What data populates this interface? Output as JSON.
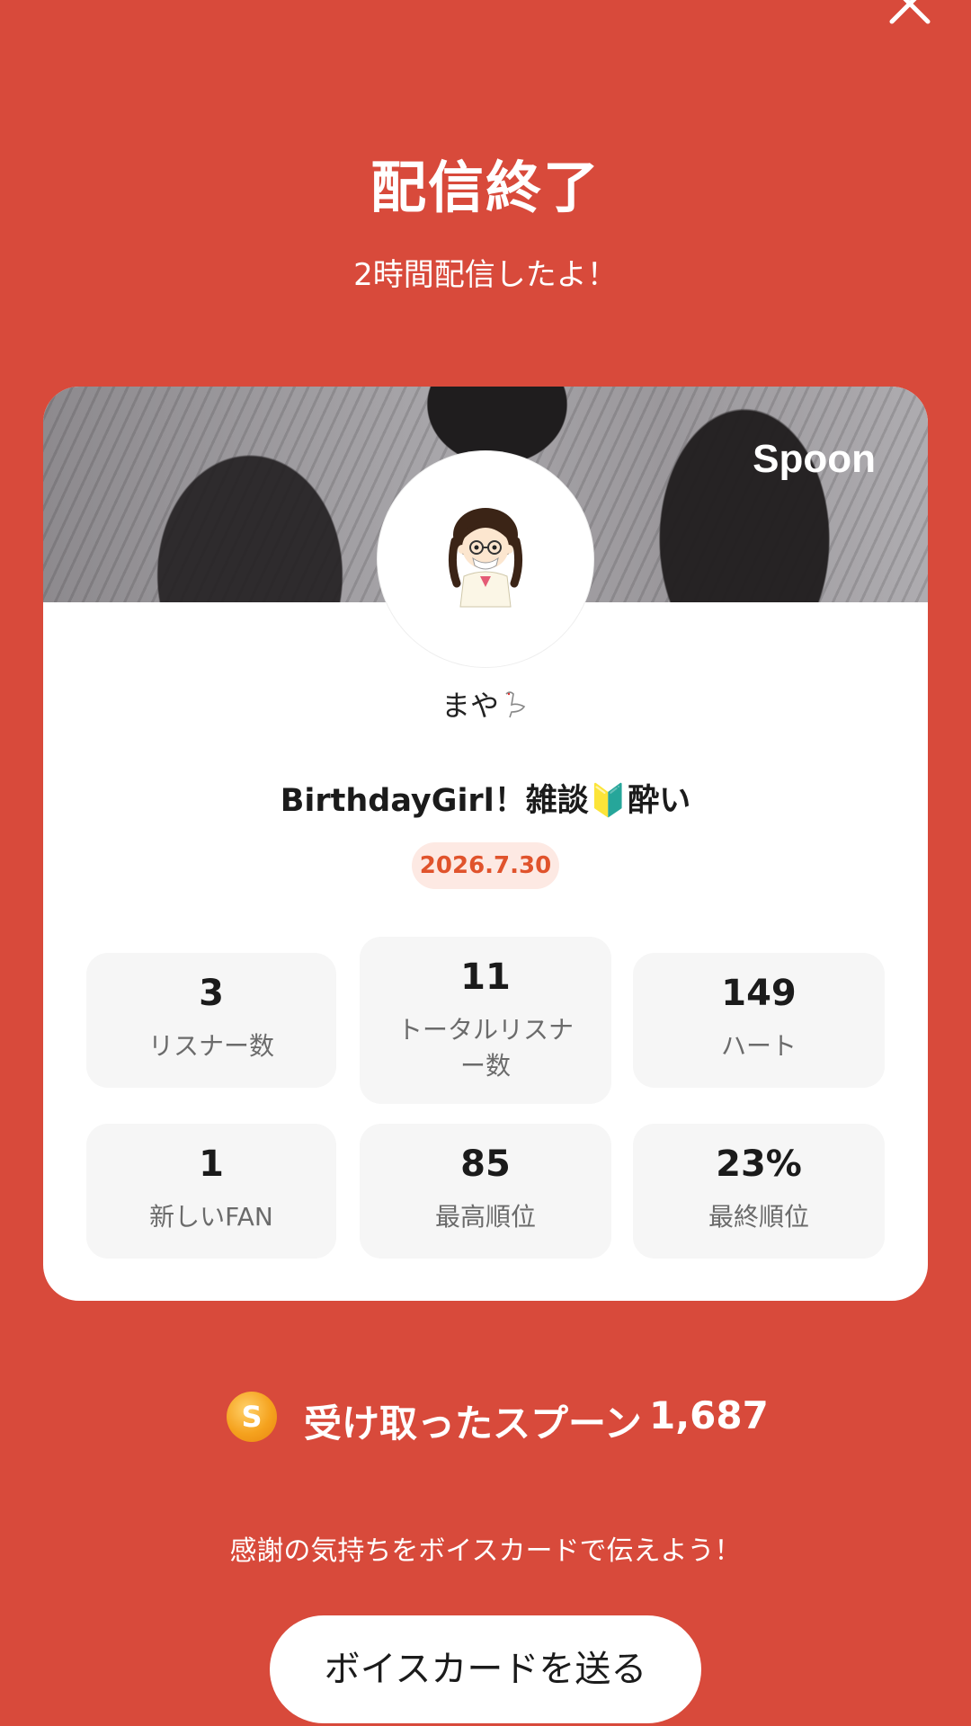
{
  "header": {
    "title": "配信終了",
    "subtitle": "2時間配信したよ！"
  },
  "card": {
    "brand": "Spoon",
    "username": "まや",
    "live_title": "BirthdayGirl！雑談🔰酔い",
    "date": "2026.7.30",
    "stats": [
      {
        "value": "3",
        "label": "リスナー数"
      },
      {
        "value": "11",
        "label": "トータルリスナー数"
      },
      {
        "value": "149",
        "label": "ハート"
      },
      {
        "value": "1",
        "label": "新しいFAN"
      },
      {
        "value": "85",
        "label": "最高順位"
      },
      {
        "value": "23%",
        "label": "最終順位"
      }
    ]
  },
  "spoons": {
    "coin_letter": "S",
    "label": "受け取ったスプーン",
    "count": "1,687"
  },
  "footer": {
    "message": "感謝の気持ちをボイスカードで伝えよう！",
    "button_label": "ボイスカードを送る"
  },
  "colors": {
    "background": "#D84A3B",
    "accent": "#E0532C",
    "badge_bg": "#FDE9E3"
  }
}
